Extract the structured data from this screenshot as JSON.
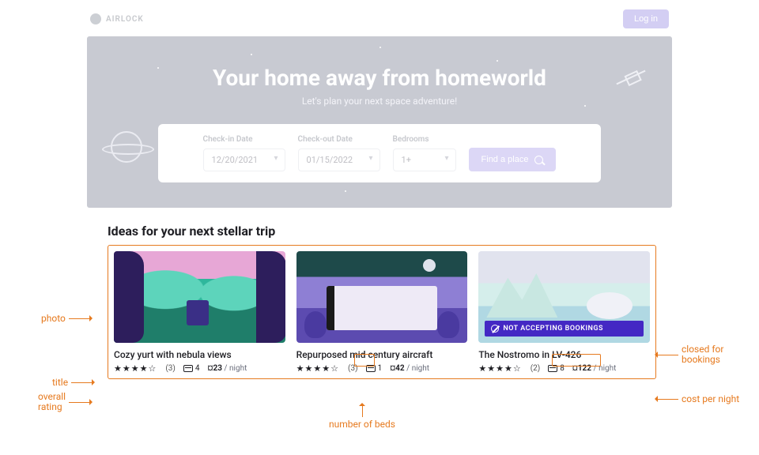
{
  "brand": "AIRLOCK",
  "login_label": "Log in",
  "hero": {
    "title": "Your home away from homeworld",
    "subtitle": "Let's plan your next space adventure!",
    "checkin_label": "Check-in Date",
    "checkin_value": "12/20/2021",
    "checkout_label": "Check-out Date",
    "checkout_value": "01/15/2022",
    "bedrooms_label": "Bedrooms",
    "bedrooms_value": "1+",
    "find_label": "Find a place"
  },
  "section_title": "Ideas for your next stellar trip",
  "closed_banner": "NOT ACCEPTING BOOKINGS",
  "listings": [
    {
      "title": "Cozy yurt with nebula views",
      "full_stars": 4,
      "empty_stars": 1,
      "review_count": "(3)",
      "beds": "4",
      "price": "¤23",
      "per": " / night",
      "closed": false
    },
    {
      "title": "Repurposed mid century aircraft",
      "full_stars": 4,
      "empty_stars": 1,
      "review_count": "(3)",
      "beds": "1",
      "price": "¤42",
      "per": " / night",
      "closed": false
    },
    {
      "title": "The Nostromo in LV-426",
      "full_stars": 4,
      "empty_stars": 1,
      "review_count": "(2)",
      "beds": "8",
      "price": "¤122",
      "per": " / night",
      "closed": true
    }
  ],
  "annotations": {
    "photo": "photo",
    "title": "title",
    "overall_rating": "overall\nrating",
    "number_of_beds": "number of beds",
    "closed_for_bookings": "closed for\nbookings",
    "cost_per_night": "cost per night"
  }
}
